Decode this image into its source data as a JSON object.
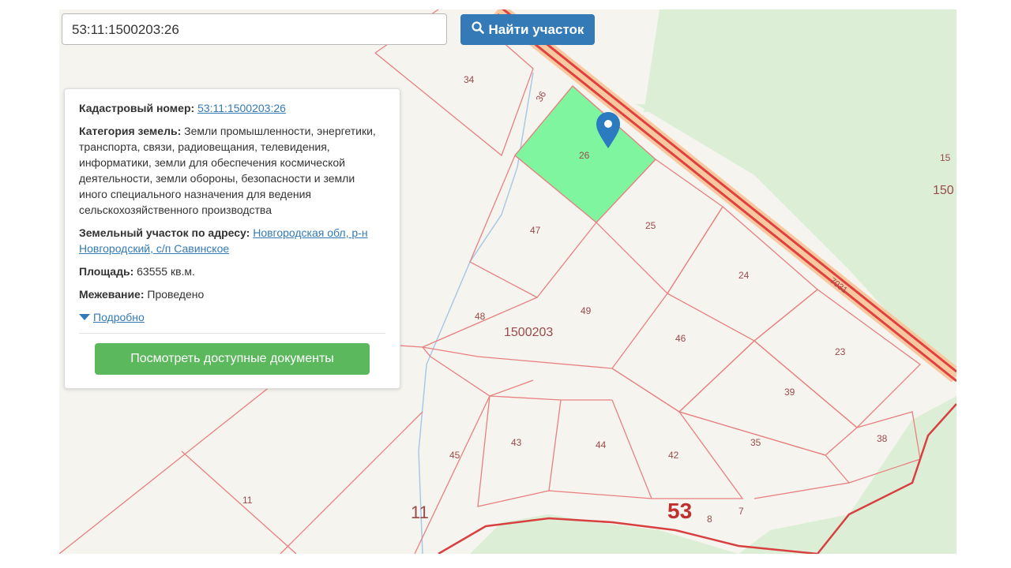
{
  "search": {
    "value": "53:11:1500203:26",
    "button_label": "Найти участок"
  },
  "info": {
    "cadastral_label": "Кадастровый номер:",
    "cadastral_value": "53:11:1500203:26",
    "category_label": "Категория земель:",
    "category_value": "Земли промышленности, энергетики, транспорта, связи, радиовещания, телевидения, информатики, земли для обеспечения космической деятельности, земли обороны, безопасности и земли иного специального назначения для ведения сельскохозяйственного производства",
    "address_label": "Земельный участок по адресу:",
    "address_value": "Новгородская обл, р-н Новгородский, с/п Савинское",
    "area_label": "Площадь:",
    "area_value": "63555 кв.м.",
    "survey_label": "Межевание:",
    "survey_value": "Проведено",
    "more_label": "Подробно",
    "docs_button": "Посмотреть доступные документы"
  },
  "map": {
    "block_label": "1500203",
    "parcels": [
      "34",
      "36",
      "26",
      "25",
      "47",
      "24",
      "48",
      "49",
      "46",
      "23",
      "39",
      "45",
      "43",
      "44",
      "42",
      "35",
      "38",
      "8",
      "7",
      "11",
      "15"
    ],
    "big_labels": [
      "11",
      "53",
      "150"
    ],
    "road_label": "7031",
    "selected_color": "#80f5a0",
    "boundary_color": "#e88080"
  }
}
